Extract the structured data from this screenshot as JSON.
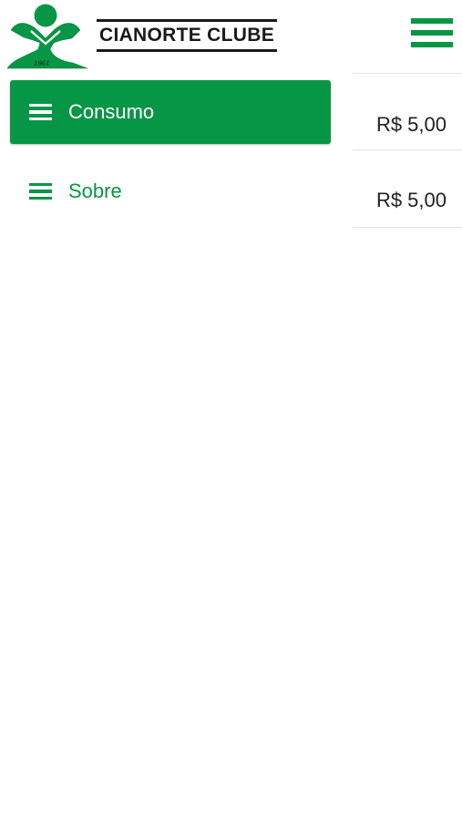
{
  "header": {
    "brand_name": "CIANORTE CLUBE",
    "logo_year": "1961"
  },
  "colors": {
    "brand_green": "#079645",
    "text_dark": "#222222",
    "divider": "#e4e4e4"
  },
  "menu": {
    "items": [
      {
        "label": "Consumo",
        "icon": "menu-lines-icon",
        "active": true
      },
      {
        "label": "Sobre",
        "icon": "menu-lines-icon",
        "active": false
      }
    ]
  },
  "list": {
    "rows": [
      {
        "price": "R$ 5,00"
      },
      {
        "price": "R$ 5,00"
      }
    ]
  }
}
